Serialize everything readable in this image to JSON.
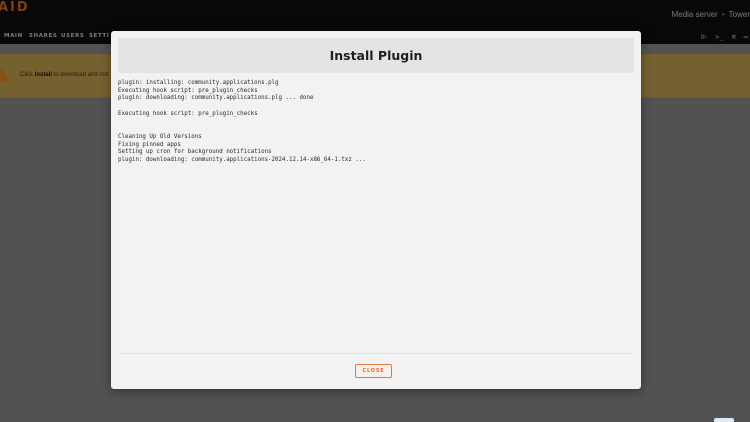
{
  "header": {
    "logo": "AID",
    "server_description": "Media server",
    "server_name": "Tower"
  },
  "nav": {
    "items": [
      {
        "label": "MAIN"
      },
      {
        "label": "SHARES"
      },
      {
        "label": "USERS"
      },
      {
        "label": "SETTI"
      }
    ],
    "icons": [
      "feedback-icon",
      "terminal-icon",
      "log-icon",
      "monitor-icon"
    ]
  },
  "notice": {
    "prefix": "Click",
    "action": "Install",
    "suffix": "to download and inst"
  },
  "modal": {
    "title": "Install Plugin",
    "log_lines": [
      "plugin: installing: community.applications.plg",
      "Executing hook script: pre_plugin_checks",
      "plugin: downloading: community.applications.plg ... done",
      "",
      "Executing hook script: pre_plugin_checks",
      "",
      "",
      "Cleaning Up Old Versions",
      "Fixing pinned apps",
      "Setting up cron for background notifications",
      "plugin: downloading: community.applications-2024.12.14-x86_64-1.txz ..."
    ],
    "close_label": "CLOSE"
  },
  "colors": {
    "accent": "#e06a1a",
    "notice_bg": "#c9a752",
    "modal_bg": "#f2f2f2"
  }
}
